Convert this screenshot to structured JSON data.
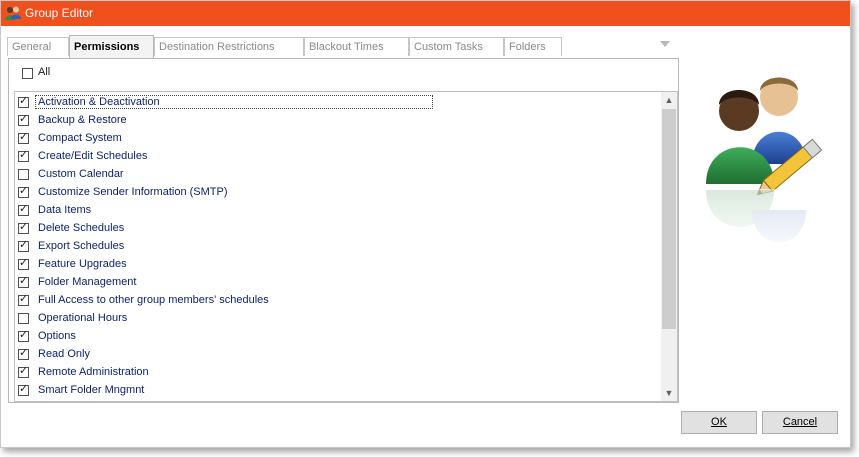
{
  "window": {
    "title": "Group Editor"
  },
  "tabs": [
    {
      "label": "General",
      "active": false
    },
    {
      "label": "Permissions",
      "active": true
    },
    {
      "label": "Destination Restrictions",
      "active": false
    },
    {
      "label": "Blackout Times",
      "active": false
    },
    {
      "label": "Custom Tasks",
      "active": false
    },
    {
      "label": "Folders",
      "active": false
    }
  ],
  "permissions": {
    "all_label": "All",
    "all_checked": false,
    "items": [
      {
        "label": "Activation & Deactivation",
        "checked": true
      },
      {
        "label": "Backup & Restore",
        "checked": true
      },
      {
        "label": "Compact System",
        "checked": true
      },
      {
        "label": "Create/Edit Schedules",
        "checked": true
      },
      {
        "label": "Custom Calendar",
        "checked": false
      },
      {
        "label": "Customize Sender Information (SMTP)",
        "checked": true
      },
      {
        "label": "Data Items",
        "checked": true
      },
      {
        "label": "Delete Schedules",
        "checked": true
      },
      {
        "label": "Export Schedules",
        "checked": true
      },
      {
        "label": "Feature Upgrades",
        "checked": true
      },
      {
        "label": "Folder Management",
        "checked": true
      },
      {
        "label": "Full Access to other group members' schedules",
        "checked": true
      },
      {
        "label": "Operational Hours",
        "checked": false
      },
      {
        "label": "Options",
        "checked": true
      },
      {
        "label": "Read Only",
        "checked": true
      },
      {
        "label": "Remote Administration",
        "checked": true
      },
      {
        "label": "Smart Folder Mngmnt",
        "checked": true
      }
    ]
  },
  "buttons": {
    "ok_label": "OK",
    "cancel_label": "Cancel"
  },
  "icons": {
    "title": "group-users-icon",
    "illustration": "users-edit-icon",
    "tab_menu": "chevron-down-icon",
    "scroll_up": "scroll-up-arrow-icon",
    "scroll_down": "scroll-down-arrow-icon"
  },
  "colors": {
    "titlebar": "#f0501e",
    "item_text": "#0b1f6e"
  }
}
